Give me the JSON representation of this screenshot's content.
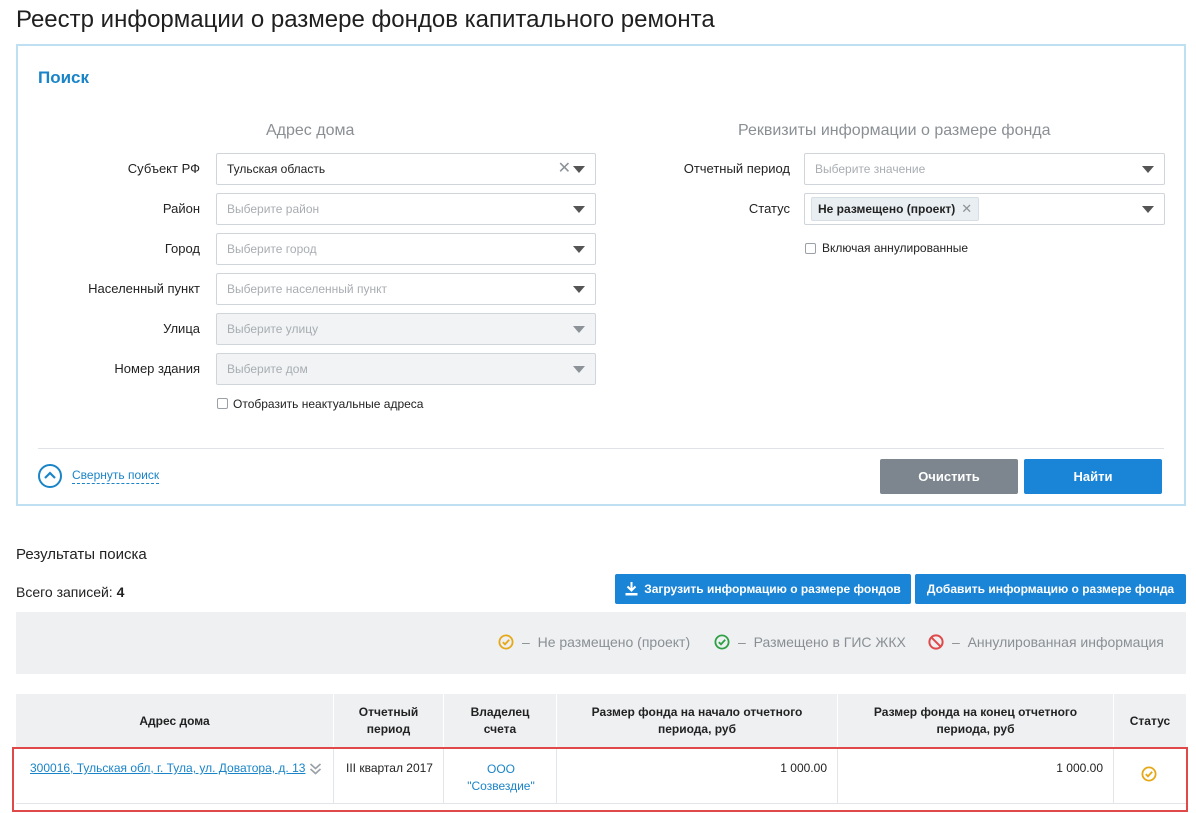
{
  "page": {
    "title": "Реестр информации о размере фондов капитального ремонта"
  },
  "search": {
    "heading": "Поиск",
    "address_group_title": "Адрес дома",
    "requisites_group_title": "Реквизиты информации о размере фонда",
    "fields": {
      "subject": {
        "label": "Субъект РФ",
        "value": "Тульская область"
      },
      "district": {
        "label": "Район",
        "placeholder": "Выберите район"
      },
      "city": {
        "label": "Город",
        "placeholder": "Выберите город"
      },
      "settlement": {
        "label": "Населенный пункт",
        "placeholder": "Выберите населенный пункт"
      },
      "street": {
        "label": "Улица",
        "placeholder": "Выберите улицу"
      },
      "building": {
        "label": "Номер здания",
        "placeholder": "Выберите дом"
      },
      "period": {
        "label": "Отчетный период",
        "placeholder": "Выберите значение"
      },
      "status": {
        "label": "Статус",
        "chip": "Не размещено (проект)"
      }
    },
    "show_irrelevant_label": "Отобразить неактуальные адреса",
    "include_annulled_label": "Включая аннулированные",
    "collapse_label": "Свернуть поиск",
    "clear_button": "Очистить",
    "find_button": "Найти"
  },
  "results": {
    "title": "Результаты поиска",
    "total_label": "Всего записей:",
    "total_count": "4",
    "upload_button": "Загрузить информацию о размере фондов",
    "add_button": "Добавить информацию о размере фонда",
    "legend": [
      {
        "dash": "–",
        "label": "Не размещено (проект)",
        "color": "#e6a817",
        "icon": "check-circle-icon"
      },
      {
        "dash": "–",
        "label": "Размещено в ГИС ЖКХ",
        "color": "#2ea043",
        "icon": "check-circle-icon"
      },
      {
        "dash": "–",
        "label": "Аннулированная информация",
        "color": "#e0494a",
        "icon": "forbidden-icon"
      }
    ]
  },
  "table": {
    "columns": [
      "Адрес дома",
      "Отчетный период",
      "Владелец счета",
      "Размер фонда на начало отчетного периода, руб",
      "Размер фонда на конец отчетного периода, руб",
      "Статус"
    ],
    "rows": [
      {
        "address": "300016, Тульская обл, г. Тула, ул. Доватора, д. 13",
        "period": "III квартал 2017",
        "owner": "ООО \"Созвездие\"",
        "start_amount": "1 000.00",
        "end_amount": "1 000.00",
        "status_icon": "check-circle-icon",
        "status_color": "#e6a817"
      }
    ]
  },
  "colors": {
    "accent": "#1a84d6",
    "highlight": "#e0494a"
  }
}
